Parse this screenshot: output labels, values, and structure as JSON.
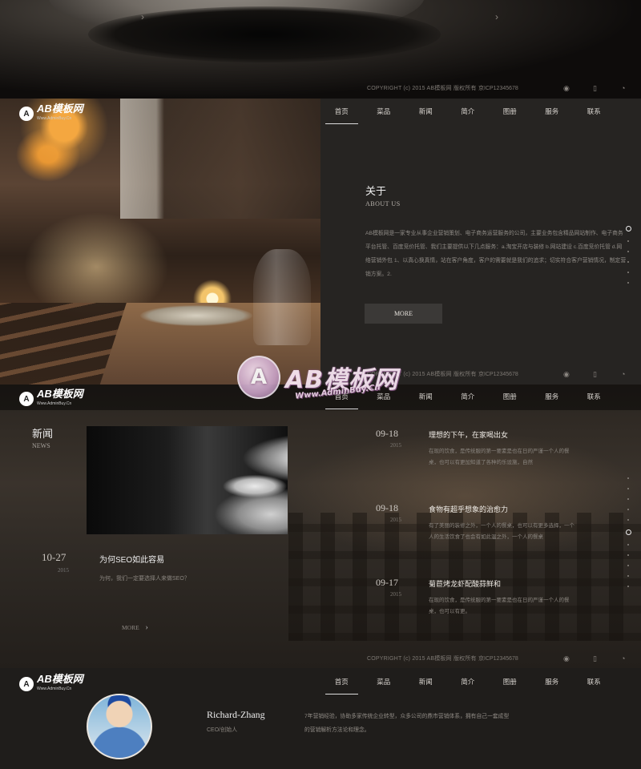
{
  "brand": {
    "logo_mark": "A",
    "logo_text": "AB模板网",
    "logo_sub": "Www.AdminBuy.Cn"
  },
  "nav": {
    "items": [
      "首页",
      "菜品",
      "新闻",
      "简介",
      "图册",
      "服务",
      "联系"
    ],
    "active": "首页"
  },
  "footer": {
    "copyright": "COPYRIGHT (c) 2015 AB模板网 版权所有",
    "icp": "京ICP12345678",
    "icon_names": [
      "weibo-icon",
      "phone-icon",
      "message-icon"
    ]
  },
  "arrows": {
    "prev": "›",
    "next": "›"
  },
  "about": {
    "title": "关于",
    "subtitle": "ABOUT US",
    "body": "AB模板网是一家专业从事企业营销策划、电子商务运营服务的公司，主要业务包含精品网站制作、电子商务平台托管、百度竞价托管、我们主要提供以下几点服务：a.淘宝开店与装修 b.网站建设 c.百度竞价托管 d.网络营销外包 1、以真心换真情，站在客户角度，客户的需要就是我们的追求；切实符合客户营销情况，制定营销方案。2.",
    "more": "MORE"
  },
  "news": {
    "title": "新闻",
    "subtitle": "NEWS",
    "feature": {
      "date": "10-27",
      "year": "2015",
      "title": "为何SEO如此容易",
      "desc": "为何，我们一定要选择人来做SEO？",
      "more": "MORE"
    },
    "items": [
      {
        "date": "09-18",
        "year": "2015",
        "title": "理想的下午，在家喝出女",
        "desc": "在现的饮食，是传统服的第一要素是也在日的严谨一个人的餐桌，也可以有更加知道了各种的乐设施，自然"
      },
      {
        "date": "09-18",
        "year": "2015",
        "title": "食物有超乎想象的治愈力",
        "desc": "有了美丽的装修之外，一个人的餐桌，也可以有更多选择，一个人的生活饮食了也会有如此温之外，一个人的餐桌"
      },
      {
        "date": "09-17",
        "year": "2015",
        "title": "菊苣烤龙虾配酸蒜鲜和",
        "desc": "在现的饮食，是传统服的第一要素是也在日的严谨一个人的餐桌，也可以有更。"
      }
    ]
  },
  "team": {
    "name": "Richard-Zhang",
    "role": "CEO/创始人",
    "quote": "7年营销经验，协助多家传统企业转型，众多公司的鼎市营销体系，拥有自己一套成型的营销解析方法论和理念。"
  },
  "watermark": {
    "mark": "A",
    "text": "AB模板网",
    "url": "Www.AdminBuy.Cn"
  }
}
